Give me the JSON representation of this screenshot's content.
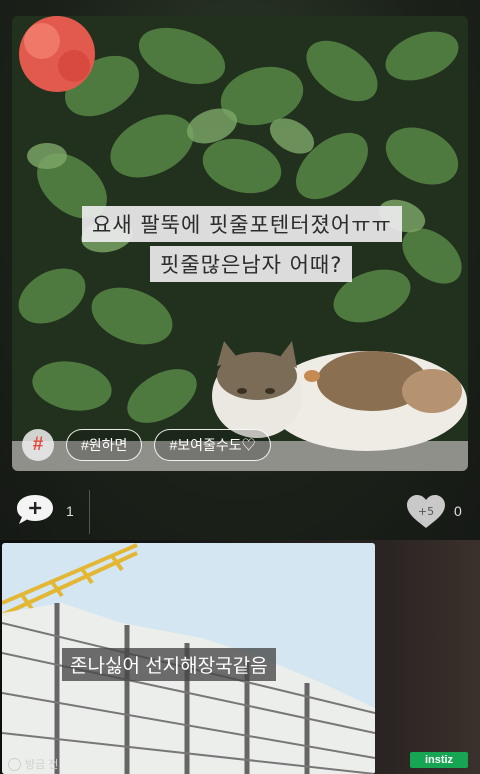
{
  "post1": {
    "caption_line1": "요새 팔뚝에 핏줄포텐터졌어ㅠㅠ",
    "caption_line2": "핏줄많은남자 어때?",
    "hash_symbol": "#",
    "tags": [
      "#원하면",
      "#보여줄수도♡"
    ],
    "comment_icon": "plus",
    "comment_count": "1",
    "like_icon": "heart-icon",
    "like_badge": "+5",
    "like_count": "0"
  },
  "post2": {
    "caption": "존나싫어 선지해장국같음",
    "footer_text": "방금 전"
  },
  "watermark": "instiz",
  "colors": {
    "accent_red": "#e24b3b",
    "watermark_green": "#17a554"
  }
}
